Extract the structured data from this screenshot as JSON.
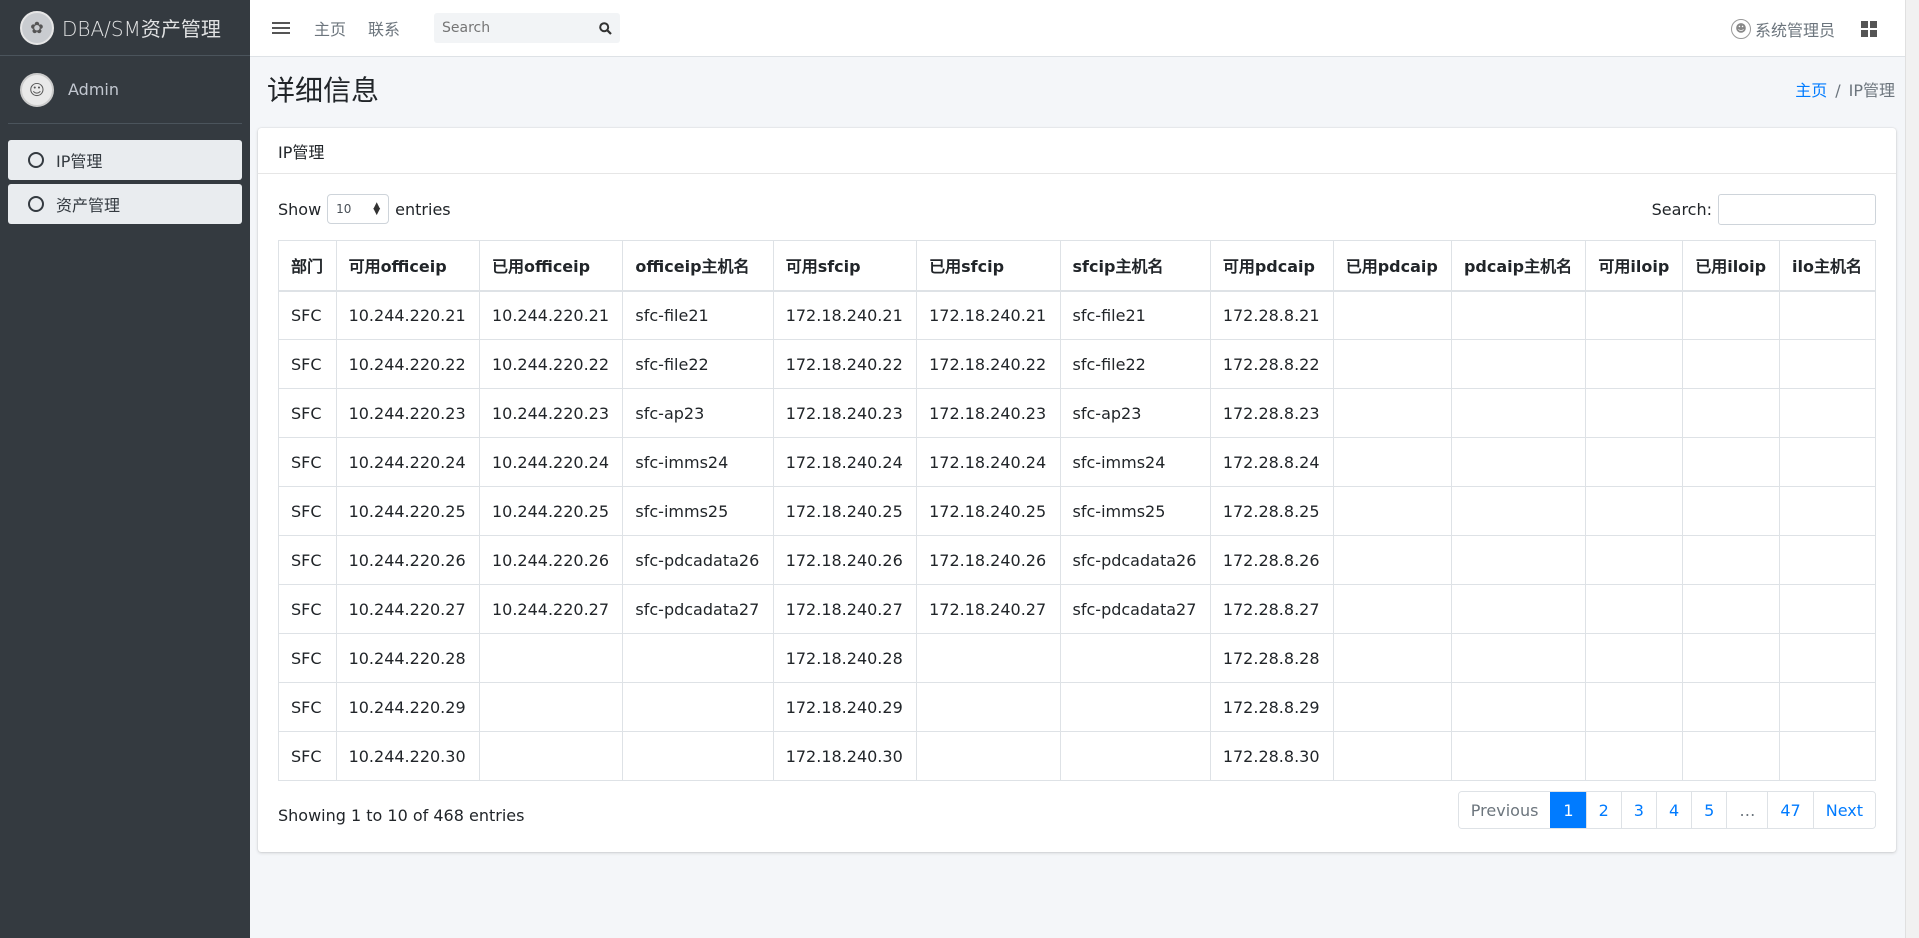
{
  "brand": {
    "title": "DBA/SM资产管理"
  },
  "user": {
    "name": "Admin"
  },
  "sidebar": {
    "items": [
      {
        "label": "IP管理"
      },
      {
        "label": "资产管理"
      }
    ]
  },
  "topbar": {
    "links": [
      "主页",
      "联系"
    ],
    "search_placeholder": "Search",
    "admin_label": "系统管理员"
  },
  "page": {
    "title": "详细信息",
    "breadcrumb": {
      "home": "主页",
      "separator": "/",
      "current": "IP管理"
    }
  },
  "card": {
    "title": "IP管理",
    "show_label": "Show",
    "entries_value": "10",
    "entries_label": "entries",
    "search_label": "Search:"
  },
  "table": {
    "columns": [
      "部门",
      "可用officeip",
      "已用officeip",
      "officeip主机名",
      "可用sfcip",
      "已用sfcip",
      "sfcip主机名",
      "可用pdcaip",
      "已用pdcaip",
      "pdcaip主机名",
      "可用iloip",
      "已用iloip",
      "ilo主机名"
    ],
    "rows": [
      [
        "SFC",
        "10.244.220.21",
        "10.244.220.21",
        "sfc-file21",
        "172.18.240.21",
        "172.18.240.21",
        "sfc-file21",
        "172.28.8.21",
        "",
        "",
        "",
        "",
        ""
      ],
      [
        "SFC",
        "10.244.220.22",
        "10.244.220.22",
        "sfc-file22",
        "172.18.240.22",
        "172.18.240.22",
        "sfc-file22",
        "172.28.8.22",
        "",
        "",
        "",
        "",
        ""
      ],
      [
        "SFC",
        "10.244.220.23",
        "10.244.220.23",
        "sfc-ap23",
        "172.18.240.23",
        "172.18.240.23",
        "sfc-ap23",
        "172.28.8.23",
        "",
        "",
        "",
        "",
        ""
      ],
      [
        "SFC",
        "10.244.220.24",
        "10.244.220.24",
        "sfc-imms24",
        "172.18.240.24",
        "172.18.240.24",
        "sfc-imms24",
        "172.28.8.24",
        "",
        "",
        "",
        "",
        ""
      ],
      [
        "SFC",
        "10.244.220.25",
        "10.244.220.25",
        "sfc-imms25",
        "172.18.240.25",
        "172.18.240.25",
        "sfc-imms25",
        "172.28.8.25",
        "",
        "",
        "",
        "",
        ""
      ],
      [
        "SFC",
        "10.244.220.26",
        "10.244.220.26",
        "sfc-pdcadata26",
        "172.18.240.26",
        "172.18.240.26",
        "sfc-pdcadata26",
        "172.28.8.26",
        "",
        "",
        "",
        "",
        ""
      ],
      [
        "SFC",
        "10.244.220.27",
        "10.244.220.27",
        "sfc-pdcadata27",
        "172.18.240.27",
        "172.18.240.27",
        "sfc-pdcadata27",
        "172.28.8.27",
        "",
        "",
        "",
        "",
        ""
      ],
      [
        "SFC",
        "10.244.220.28",
        "",
        "",
        "172.18.240.28",
        "",
        "",
        "172.28.8.28",
        "",
        "",
        "",
        "",
        ""
      ],
      [
        "SFC",
        "10.244.220.29",
        "",
        "",
        "172.18.240.29",
        "",
        "",
        "172.28.8.29",
        "",
        "",
        "",
        "",
        ""
      ],
      [
        "SFC",
        "10.244.220.30",
        "",
        "",
        "172.18.240.30",
        "",
        "",
        "172.28.8.30",
        "",
        "",
        "",
        "",
        ""
      ]
    ]
  },
  "footer": {
    "info": "Showing 1 to 10 of 468 entries",
    "pagination": [
      "Previous",
      "1",
      "2",
      "3",
      "4",
      "5",
      "…",
      "47",
      "Next"
    ],
    "active_page": "1"
  },
  "colors": {
    "sidebar": "#343a40",
    "accent": "#007bff",
    "background": "#f4f6f9"
  }
}
